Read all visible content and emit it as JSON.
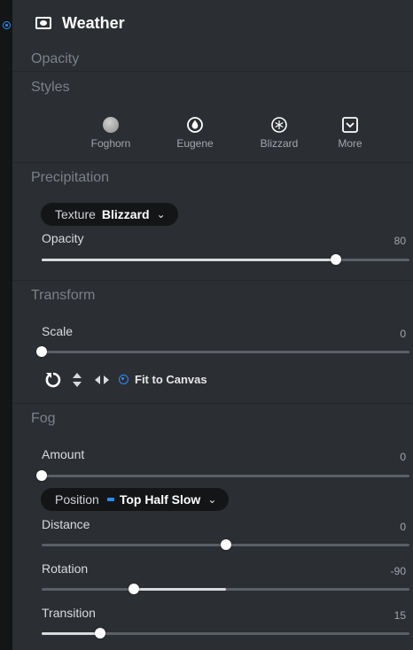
{
  "colors": {
    "accent": "#2a8cff",
    "panel": "#2b2e32",
    "track": "#5b5f66",
    "fill": "#d9dadc"
  },
  "header": {
    "title": "Weather"
  },
  "sections": {
    "opacity": "Opacity",
    "styles": "Styles",
    "precipitation": "Precipitation",
    "transform": "Transform",
    "fog": "Fog"
  },
  "styles": [
    {
      "label": "Foghorn",
      "icon": "gray-sphere-icon"
    },
    {
      "label": "Eugene",
      "icon": "drop-icon"
    },
    {
      "label": "Blizzard",
      "icon": "snowflake-icon"
    },
    {
      "label": "More",
      "icon": "chevron-box-icon"
    }
  ],
  "precipitation": {
    "texture_key": "Texture",
    "texture_value": "Blizzard",
    "opacity_label": "Opacity",
    "opacity_value": "80",
    "opacity_level": 0.8
  },
  "transform": {
    "scale_label": "Scale",
    "scale_value": "0",
    "scale_level": 0.0,
    "fit_label": "Fit to Canvas"
  },
  "fog": {
    "amount_label": "Amount",
    "amount_value": "0",
    "amount_level": 0.0,
    "position_key": "Position",
    "position_value": "Top Half Slow",
    "distance_label": "Distance",
    "distance_value": "0",
    "distance_level": 0.5,
    "rotation_label": "Rotation",
    "rotation_value": "-90",
    "rotation_level": 0.25,
    "transition_label": "Transition",
    "transition_value": "15",
    "transition_level": 0.16
  }
}
